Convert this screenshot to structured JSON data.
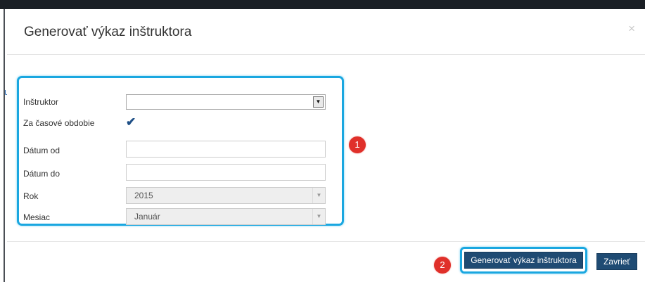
{
  "dialog": {
    "title": "Generovať výkaz inštruktora",
    "close_label": "×"
  },
  "background": {
    "fragment_text": "u"
  },
  "form": {
    "instructor_label": "Inštruktor",
    "instructor_value": "",
    "period_label": "Za časové obdobie",
    "period_checked": true,
    "date_from_label": "Dátum od",
    "date_from_value": "",
    "date_to_label": "Dátum do",
    "date_to_value": "",
    "year_label": "Rok",
    "year_value": "2015",
    "month_label": "Mesiac",
    "month_value": "Január"
  },
  "annotations": {
    "badge_1": "1",
    "badge_2": "2"
  },
  "footer": {
    "generate_label": "Generovať výkaz inštruktora",
    "close_label": "Zavrieť"
  },
  "colors": {
    "highlight": "#1aa7e0",
    "badge": "#e0302a",
    "button": "#1f4b73",
    "checkmark": "#1e4f86"
  },
  "icons": {
    "close": "close-icon",
    "check": "checkmark-icon",
    "dropdown": "chevron-down-icon"
  }
}
